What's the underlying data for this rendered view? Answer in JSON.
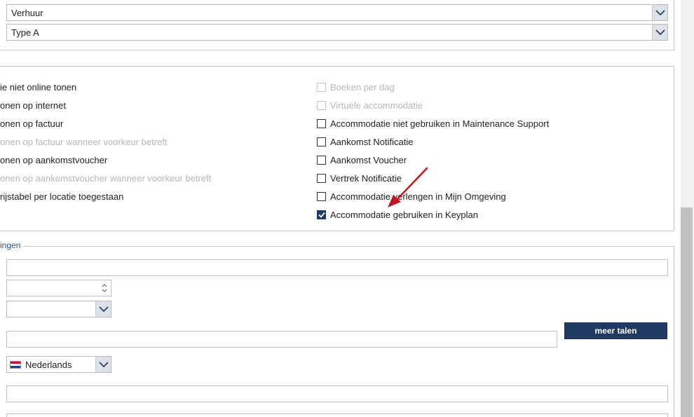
{
  "top_selects": [
    {
      "value": "Verhuur"
    },
    {
      "value": "Type A"
    }
  ],
  "left_options": [
    {
      "label": "ie niet online tonen",
      "disabled": false
    },
    {
      "label": "onen op internet",
      "disabled": false
    },
    {
      "label": "onen op factuur",
      "disabled": false
    },
    {
      "label": "onen op factuur wanneer voorkeur betreft",
      "disabled": true
    },
    {
      "label": "onen op aankomstvoucher",
      "disabled": false
    },
    {
      "label": "onen op aankomstvoucher wanneer voorkeur betreft",
      "disabled": true
    },
    {
      "label": "rijstabel per locatie toegestaan",
      "disabled": false
    }
  ],
  "right_options": [
    {
      "label": "Boeken per dag",
      "checked": false,
      "disabled": true
    },
    {
      "label": "Virtuele accommodatie",
      "checked": false,
      "disabled": true
    },
    {
      "label": "Accommodatie niet gebruiken in Maintenance Support",
      "checked": false,
      "disabled": false
    },
    {
      "label": "Aankomst Notificatie",
      "checked": false,
      "disabled": false
    },
    {
      "label": "Aankomst Voucher",
      "checked": false,
      "disabled": false
    },
    {
      "label": "Vertrek Notificatie",
      "checked": false,
      "disabled": false
    },
    {
      "label": "Accommodatie verlengen in Mijn Omgeving",
      "checked": false,
      "disabled": false
    },
    {
      "label": "Accommodatie gebruiken in Keyplan",
      "checked": true,
      "disabled": false
    }
  ],
  "fieldset": {
    "legend": "ingen",
    "text_field_1": "",
    "number_field": "",
    "select_1": "",
    "text_field_2": "",
    "more_languages_button": "meer talen",
    "language_select": "Nederlands",
    "text_field_3": ""
  },
  "colors": {
    "primary": "#1f3a63",
    "arrow": "#c0161d",
    "disabled_text": "#b6b6b6"
  }
}
